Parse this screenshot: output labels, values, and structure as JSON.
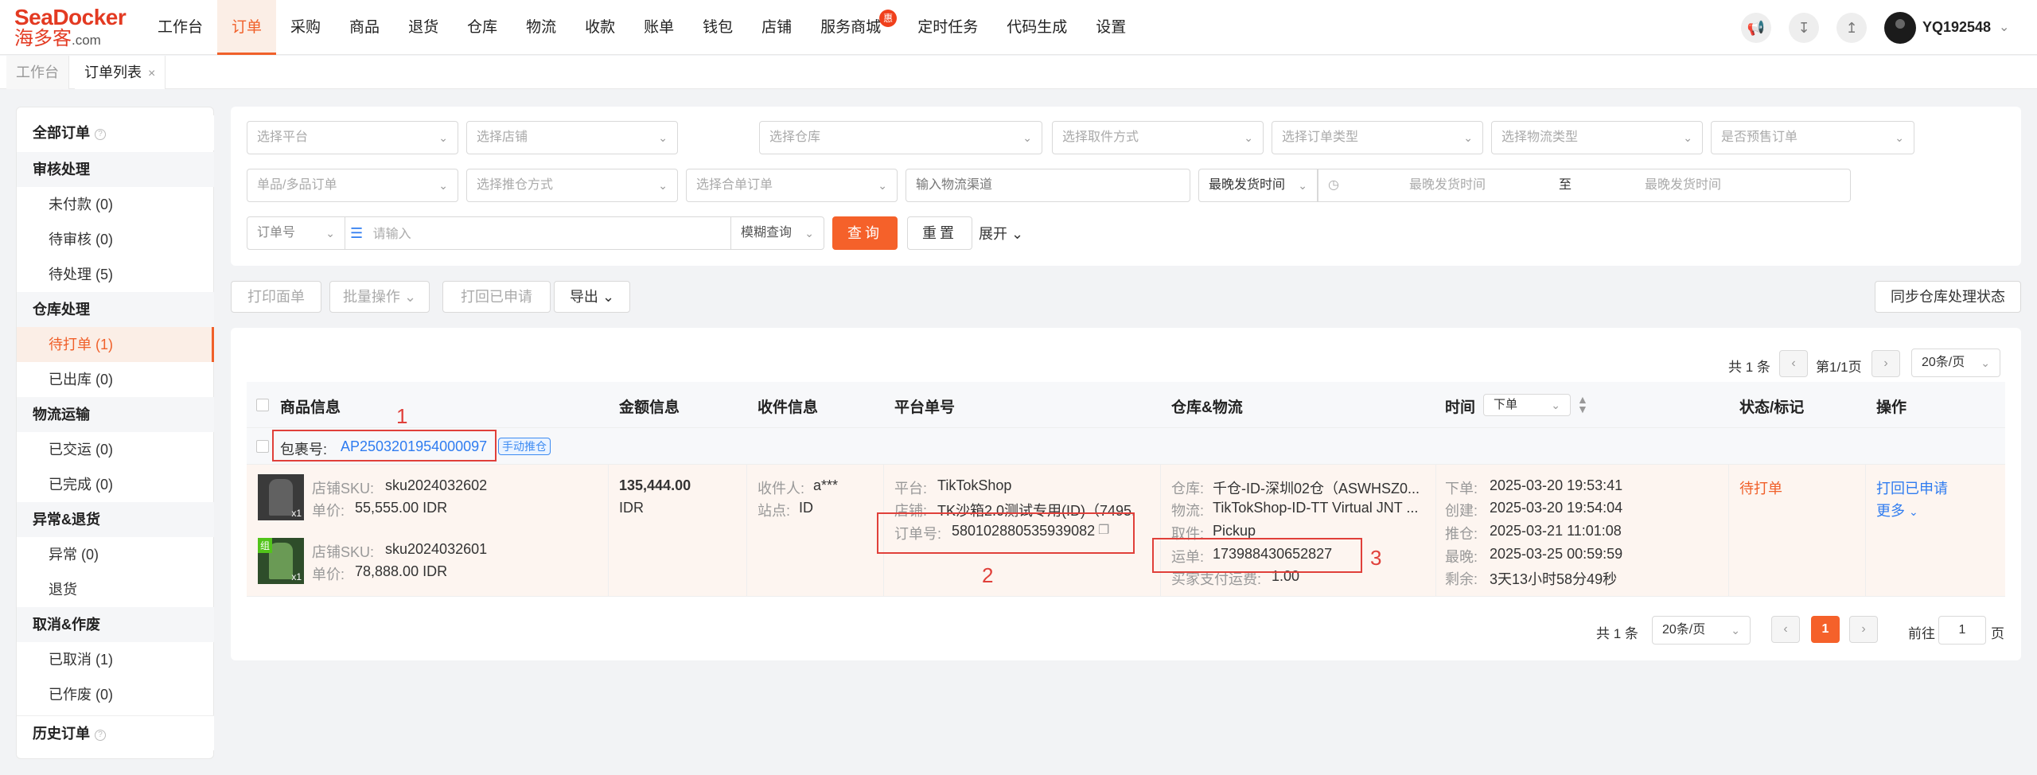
{
  "brand": {
    "logo_top": "SeaDocker",
    "logo_cn": "海多客",
    "logo_dom": ".com"
  },
  "nav": [
    "工作台",
    "订单",
    "采购",
    "商品",
    "退货",
    "仓库",
    "物流",
    "收款",
    "账单",
    "钱包",
    "店铺",
    "服务商城",
    "定时任务",
    "代码生成",
    "设置"
  ],
  "nav_badge": "惠",
  "user": {
    "name": "YQ192548"
  },
  "tabs": {
    "home": "工作台",
    "orders": "订单列表",
    "close": "×"
  },
  "sidebar": {
    "all_orders": "全部订单",
    "group_review": "审核处理",
    "unpaid": "未付款 (0)",
    "pending_review": "待审核 (0)",
    "pending_process": "待处理 (5)",
    "group_warehouse": "仓库处理",
    "to_print": "待打单 (1)",
    "shipped_out": "已出库 (0)",
    "group_logistics": "物流运输",
    "delivered": "已交运 (0)",
    "completed": "已完成 (0)",
    "group_exception": "异常&退货",
    "exception": "异常 (0)",
    "returns": "退货",
    "group_cancel": "取消&作废",
    "cancelled": "已取消 (1)",
    "voided": "已作废 (0)",
    "history": "历史订单"
  },
  "filters": {
    "platform": "选择平台",
    "shop": "选择店铺",
    "warehouse": "选择仓库",
    "pickup": "选择取件方式",
    "order_type": "选择订单类型",
    "logistics_type": "选择物流类型",
    "presale": "是否预售订单",
    "single_multi": "单品/多品订单",
    "push_method": "选择推仓方式",
    "merge": "选择合单订单",
    "channel_placeholder": "输入物流渠道",
    "time_type": "最晚发货时间",
    "time_start": "最晚发货时间",
    "time_to": "至",
    "time_end": "最晚发货时间",
    "order_no": "订单号",
    "keyword_placeholder": "请输入",
    "fuzzy": "模糊查询",
    "query": "查询",
    "reset": "重置",
    "expand": "展开"
  },
  "toolbar": {
    "print_label": "打印面单",
    "batch": "批量操作",
    "print_requested": "打回已申请",
    "export": "导出",
    "sync": "同步仓库处理状态"
  },
  "pager_top": {
    "total": "共 1 条",
    "page": "第1/1页",
    "size": "20条/页"
  },
  "table": {
    "headers": {
      "product": "商品信息",
      "amount": "金额信息",
      "receiver": "收件信息",
      "platform_no": "平台单号",
      "warehouse": "仓库&物流",
      "time": "时间",
      "time_select": "下单",
      "status": "状态/标记",
      "action": "操作"
    },
    "package_label": "包裹号:",
    "package_no": "AP2503201954000097",
    "package_tag": "手动推仓",
    "items": [
      {
        "sku_label": "店铺SKU:",
        "sku": "sku2024032602",
        "price_label": "单价:",
        "price": "55,555.00 IDR",
        "qty": "x1"
      },
      {
        "sku_label": "店铺SKU:",
        "sku": "sku2024032601",
        "price_label": "单价:",
        "price": "78,888.00 IDR",
        "qty": "x1",
        "tag": "组"
      }
    ],
    "amount": "135,444.00",
    "currency": "IDR",
    "receiver_label": "收件人:",
    "receiver": "a***",
    "site_label": "站点:",
    "site": "ID",
    "platform_label": "平台:",
    "platform": "TikTokShop",
    "store_label": "店铺:",
    "store": "TK沙箱2.0测试专用(ID)（7495...",
    "order_label": "订单号:",
    "order_no": "580102880535939082",
    "wh_label": "仓库:",
    "wh": "千仓-ID-深圳02仓（ASWHSZ0...",
    "logistics_label": "物流:",
    "logistics": "TikTokShop-ID-TT Virtual JNT ...",
    "pickup_label": "取件:",
    "pickup": "Pickup",
    "waybill_label": "运单:",
    "waybill": "173988430652827",
    "freight_label": "买家支付运费:",
    "freight": "1.00",
    "times": [
      {
        "label": "下单:",
        "value": "2025-03-20 19:53:41"
      },
      {
        "label": "创建:",
        "value": "2025-03-20 19:54:04"
      },
      {
        "label": "推仓:",
        "value": "2025-03-21 11:01:08"
      },
      {
        "label": "最晚:",
        "value": "2025-03-25 00:59:59"
      },
      {
        "label": "剩余:",
        "value": "3天13小时58分49秒"
      }
    ],
    "status": "待打单",
    "action_primary": "打回已申请",
    "action_more": "更多"
  },
  "annotations": [
    "1",
    "2",
    "3"
  ],
  "pager_bottom": {
    "total": "共 1 条",
    "size": "20条/页",
    "current": "1",
    "goto": "前往",
    "goto_value": "1",
    "page_unit": "页"
  }
}
